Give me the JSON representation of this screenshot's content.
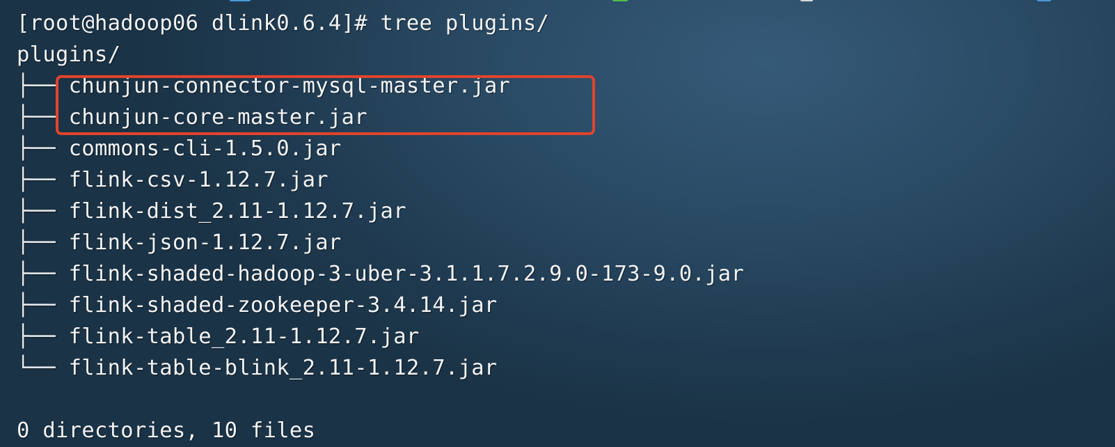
{
  "terminal": {
    "prompt_line": "[root@hadoop06 dlink0.6.4]# tree plugins/",
    "root_dir": "plugins/",
    "entries": [
      {
        "branch": "├── ",
        "name": "chunjun-connector-mysql-master.jar"
      },
      {
        "branch": "├── ",
        "name": "chunjun-core-master.jar"
      },
      {
        "branch": "├── ",
        "name": "commons-cli-1.5.0.jar"
      },
      {
        "branch": "├── ",
        "name": "flink-csv-1.12.7.jar"
      },
      {
        "branch": "├── ",
        "name": "flink-dist_2.11-1.12.7.jar"
      },
      {
        "branch": "├── ",
        "name": "flink-json-1.12.7.jar"
      },
      {
        "branch": "├── ",
        "name": "flink-shaded-hadoop-3-uber-3.1.1.7.2.9.0-173-9.0.jar"
      },
      {
        "branch": "├── ",
        "name": "flink-shaded-zookeeper-3.4.14.jar"
      },
      {
        "branch": "├── ",
        "name": "flink-table_2.11-1.12.7.jar"
      },
      {
        "branch": "└── ",
        "name": "flink-table-blink_2.11-1.12.7.jar"
      }
    ],
    "summary": "0 directories, 10 files"
  },
  "colors": {
    "text": "#f2f4f6",
    "highlight_border": "#e0442c",
    "background": "#2a4a64"
  }
}
